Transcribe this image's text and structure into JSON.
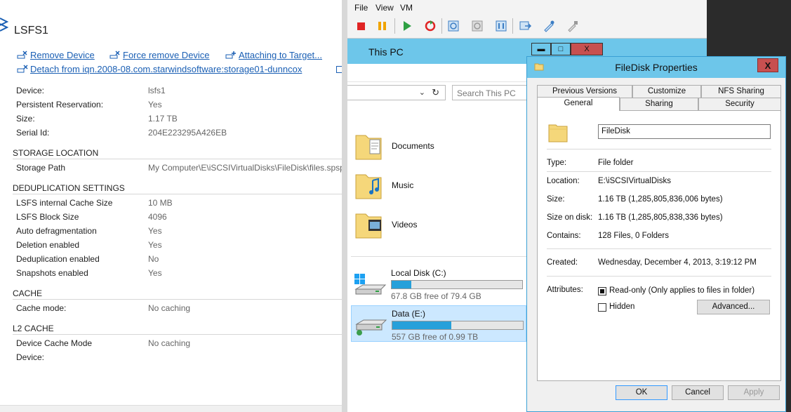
{
  "device_panel": {
    "title": "LSFS1",
    "actions": {
      "remove": "Remove Device",
      "force_remove": "Force remove Device",
      "attaching": "Attaching to Target...",
      "detach": "Detach from iqn.2008-08.com.starwindsoftware:storage01-dunncox"
    },
    "props": [
      {
        "key": "Device:",
        "val": "lsfs1"
      },
      {
        "key": "Persistent Reservation:",
        "val": "Yes"
      },
      {
        "key": "Size:",
        "val": "1.17 TB"
      },
      {
        "key": "Serial Id:",
        "val": "204E223295A426EB"
      }
    ],
    "storage_location": {
      "header": "STORAGE LOCATION",
      "key": "Storage Path",
      "val": "My Computer\\E\\iSCSIVirtualDisks\\FileDisk\\files.spsp"
    },
    "dedup": {
      "header": "DEDUPLICATION SETTINGS",
      "rows": [
        {
          "key": "LSFS internal Cache Size",
          "val": "10 MB"
        },
        {
          "key": "LSFS Block Size",
          "val": "4096"
        },
        {
          "key": "Auto defragmentation",
          "val": "Yes"
        },
        {
          "key": "Deletion enabled",
          "val": "Yes"
        },
        {
          "key": "Deduplication enabled",
          "val": "No"
        },
        {
          "key": "Snapshots enabled",
          "val": "Yes"
        }
      ]
    },
    "cache": {
      "header": "CACHE",
      "key": "Cache mode:",
      "val": "No caching"
    },
    "l2cache": {
      "header": "L2 CACHE",
      "rows": [
        {
          "key": "Device Cache Mode",
          "val": "No caching"
        },
        {
          "key": "Device:",
          "val": ""
        }
      ]
    }
  },
  "vm_console": {
    "menu": [
      "File",
      "View",
      "VM"
    ]
  },
  "explorer": {
    "title": "This PC",
    "window_buttons": {
      "minimize": "▬",
      "maximize": "□",
      "close": "X"
    },
    "search_placeholder": "Search This PC",
    "folders": [
      "Documents",
      "Music",
      "Videos"
    ],
    "drives": [
      {
        "name": "Local Disk (C:)",
        "free": "67.8 GB free of 79.4 GB",
        "used_fraction": 0.15,
        "selected": false
      },
      {
        "name": "Data (E:)",
        "free": "557 GB free of 0.99 TB",
        "used_fraction": 0.45,
        "selected": true
      }
    ],
    "accent": "#6dc6ea"
  },
  "dialog": {
    "title": "FileDisk Properties",
    "close": "X",
    "tabs_back": [
      "Previous Versions",
      "Customize",
      "NFS Sharing"
    ],
    "tabs_front": [
      "General",
      "Sharing",
      "Security"
    ],
    "name": "FileDisk",
    "type_label": "Type:",
    "type_val": "File folder",
    "location_label": "Location:",
    "location_val": "E:\\iSCSIVirtualDisks",
    "size_label": "Size:",
    "size_val": "1.16 TB (1,285,805,836,006 bytes)",
    "size_disk_label": "Size on disk:",
    "size_disk_val": "1.16 TB (1,285,805,838,336 bytes)",
    "contains_label": "Contains:",
    "contains_val": "128 Files, 0 Folders",
    "created_label": "Created:",
    "created_val": "Wednesday, December 4, 2013, 3:19:12 PM",
    "attributes_label": "Attributes:",
    "readonly_label": "Read-only (Only applies to files in folder)",
    "hidden_label": "Hidden",
    "advanced_button": "Advanced...",
    "ok_button": "OK",
    "cancel_button": "Cancel",
    "apply_button": "Apply"
  }
}
